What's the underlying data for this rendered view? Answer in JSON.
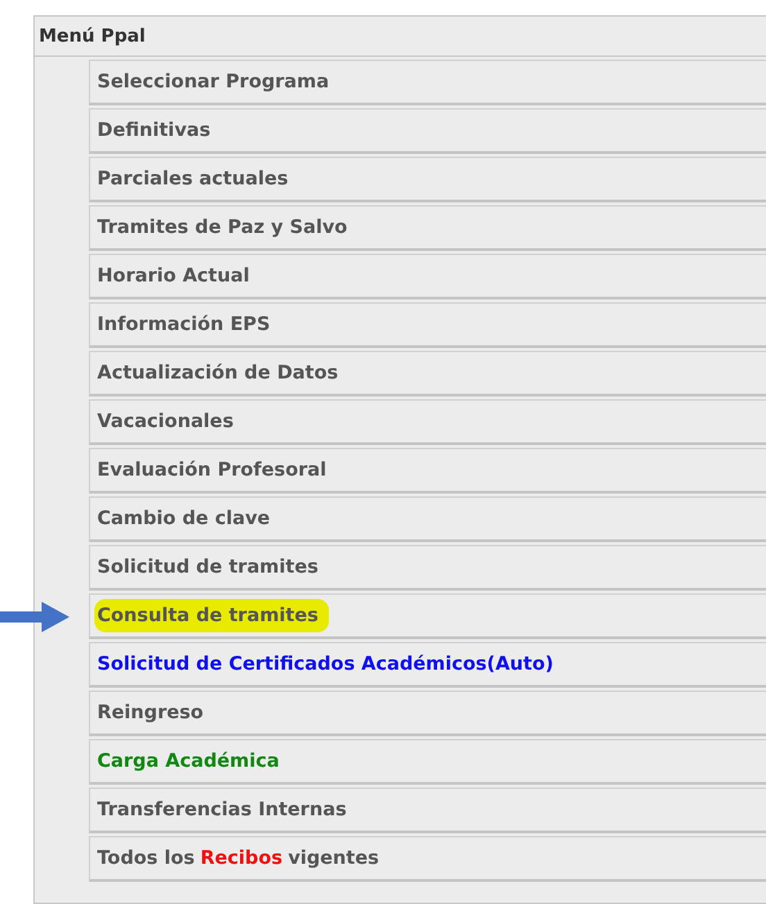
{
  "menu": {
    "title": "Menú Ppal",
    "items": [
      {
        "highlighted": false,
        "segments": [
          {
            "text": "Seleccionar Programa",
            "color": "#555555"
          }
        ]
      },
      {
        "highlighted": false,
        "segments": [
          {
            "text": "Definitivas",
            "color": "#555555"
          }
        ]
      },
      {
        "highlighted": false,
        "segments": [
          {
            "text": "Parciales actuales",
            "color": "#555555"
          }
        ]
      },
      {
        "highlighted": false,
        "segments": [
          {
            "text": "Tramites de Paz y Salvo",
            "color": "#555555"
          }
        ]
      },
      {
        "highlighted": false,
        "segments": [
          {
            "text": "Horario Actual",
            "color": "#555555"
          }
        ]
      },
      {
        "highlighted": false,
        "segments": [
          {
            "text": "Información EPS",
            "color": "#555555"
          }
        ]
      },
      {
        "highlighted": false,
        "segments": [
          {
            "text": "Actualización de Datos",
            "color": "#555555"
          }
        ]
      },
      {
        "highlighted": false,
        "segments": [
          {
            "text": "Vacacionales",
            "color": "#555555"
          }
        ]
      },
      {
        "highlighted": false,
        "segments": [
          {
            "text": "Evaluación Profesoral",
            "color": "#555555"
          }
        ]
      },
      {
        "highlighted": false,
        "segments": [
          {
            "text": "Cambio de clave",
            "color": "#555555"
          }
        ]
      },
      {
        "highlighted": false,
        "segments": [
          {
            "text": "Solicitud de tramites",
            "color": "#555555"
          }
        ]
      },
      {
        "highlighted": true,
        "segments": [
          {
            "text": "Consulta de tramites",
            "color": "#555555"
          }
        ]
      },
      {
        "highlighted": false,
        "segments": [
          {
            "text": "Solicitud de Certificados Académicos(Auto)",
            "color": "#1010ee"
          }
        ]
      },
      {
        "highlighted": false,
        "segments": [
          {
            "text": "Reingreso",
            "color": "#555555"
          }
        ]
      },
      {
        "highlighted": false,
        "segments": [
          {
            "text": "Carga Académica",
            "color": "#118811"
          }
        ]
      },
      {
        "highlighted": false,
        "segments": [
          {
            "text": "Transferencias Internas",
            "color": "#555555"
          }
        ]
      },
      {
        "highlighted": false,
        "segments": [
          {
            "text": "Todos los",
            "color": "#555555"
          },
          {
            "text": "Recibos",
            "color": "#ee1111"
          },
          {
            "text": "vigentes",
            "color": "#555555"
          }
        ]
      }
    ]
  }
}
